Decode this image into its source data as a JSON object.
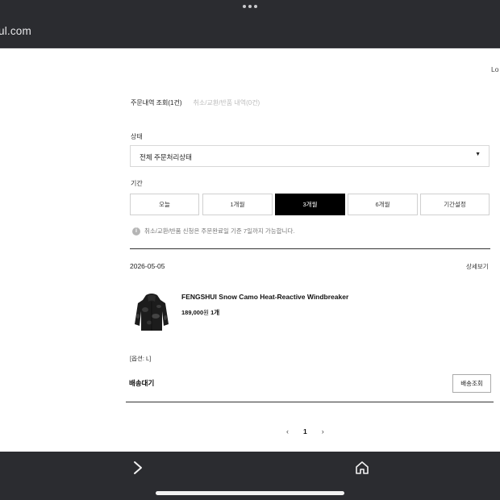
{
  "browser": {
    "url": "ul.com"
  },
  "header": {
    "login_label": "Lo"
  },
  "tabs": [
    {
      "label": "주문내역 조회(1건)",
      "active": true
    },
    {
      "label": "취소/교환/반품 내역(0건)",
      "active": false
    }
  ],
  "filters": {
    "status_label": "상태",
    "status_value": "전체 주문처리상태",
    "period_label": "기간",
    "period_buttons": [
      "오늘",
      "1개월",
      "3개월",
      "6개월",
      "기간설정"
    ],
    "period_selected": "3개월",
    "notice": "취소/교환/반품 신청은 주문완료일 기준 7일까지 가능합니다."
  },
  "order": {
    "date": "2026-05-05",
    "detail_link": "상세보기",
    "product_name": "FENGSHUI Snow Camo Heat-Reactive Windbreaker",
    "price": "189,000",
    "currency": "원",
    "quantity": "1개",
    "option": "[옵션: L]",
    "shipping_status": "배송대기",
    "track_button": "배송조회"
  },
  "pagination": {
    "prev": "‹",
    "current": "1",
    "next": "›"
  },
  "toolbar": {
    "forward_icon": "chevron-right-icon",
    "home_icon": "home-icon"
  },
  "colors": {
    "chrome": "#2b2c30",
    "accent_active": "#000000"
  }
}
